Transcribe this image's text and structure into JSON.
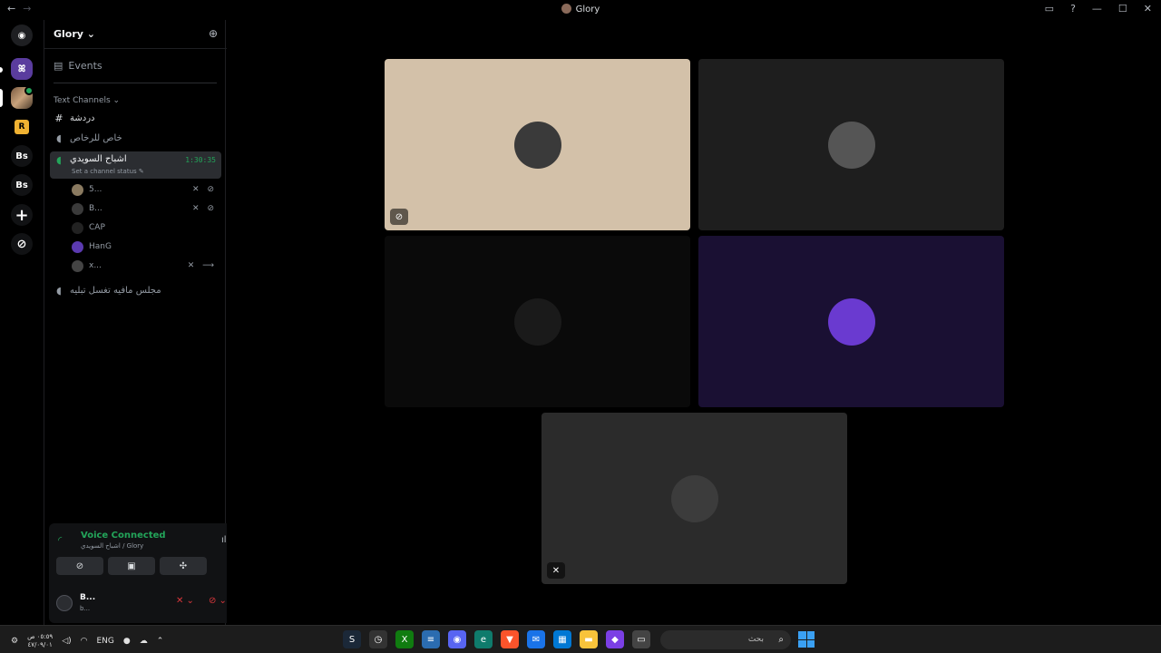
{
  "window": {
    "title": "Glory",
    "nav_back": "←",
    "nav_forward": "→",
    "inbox_icon": "inbox-icon",
    "help_icon": "help-icon"
  },
  "guilds": [
    {
      "name": "discord-home",
      "label": ""
    },
    {
      "name": "server-1",
      "label": "ꕤ"
    },
    {
      "name": "server-2",
      "label": ""
    },
    {
      "name": "server-r",
      "label": "R"
    },
    {
      "name": "server-bs-1",
      "label": "Bs"
    },
    {
      "name": "server-bs-2",
      "label": "Bs"
    },
    {
      "name": "add-server",
      "label": "+"
    },
    {
      "name": "explore",
      "label": "⊘"
    }
  ],
  "sidebar": {
    "server_name": "Glory ⌄",
    "events_label": "Events",
    "category": "Text Channels ⌄",
    "channels": [
      {
        "name": "دردشة",
        "type": "text"
      },
      {
        "name": "خاص للرخاص",
        "type": "voice"
      },
      {
        "name": "اشباح السويدي",
        "type": "voice",
        "time": "1:30:35",
        "status": "Set a channel status ✎"
      },
      {
        "name": "مجلس مافيه تغسل تبليه",
        "type": "voice"
      }
    ],
    "voice_users": [
      {
        "name": "5...",
        "flags": "✕ ⊘"
      },
      {
        "name": "B...",
        "flags": "✕ ⊘"
      },
      {
        "name": "CAP",
        "flags": ""
      },
      {
        "name": "HanG",
        "flags": ""
      },
      {
        "name": "x...",
        "flags": "✕ ⟶"
      }
    ]
  },
  "voice_panel": {
    "title": "Voice Connected",
    "subtitle": "اشباح السويدي / Glory",
    "user_name": "B...",
    "user_sub": "b..."
  },
  "taskbar": {
    "time": "٠٥:٥٩ ص",
    "date": "٤٧/٠٩/٠١",
    "lang": "ENG",
    "search_placeholder": "بحث"
  },
  "tiles": [
    {
      "name": "video-tile-1",
      "bg": "#d3c1a9",
      "avatar": "#3a3a3a",
      "flag": "⊘"
    },
    {
      "name": "video-tile-2",
      "bg": "#1e1e1e",
      "avatar": "#555555",
      "flag": ""
    },
    {
      "name": "video-tile-3",
      "bg": "#0a0a0a",
      "avatar": "#1a1a1a",
      "flag": ""
    },
    {
      "name": "video-tile-4",
      "bg": "#1a1033",
      "avatar": "#6a3ad0",
      "flag": ""
    },
    {
      "name": "video-tile-5",
      "bg": "#2b2b2b",
      "avatar": "#3c3c3c",
      "flag": "✕"
    }
  ]
}
